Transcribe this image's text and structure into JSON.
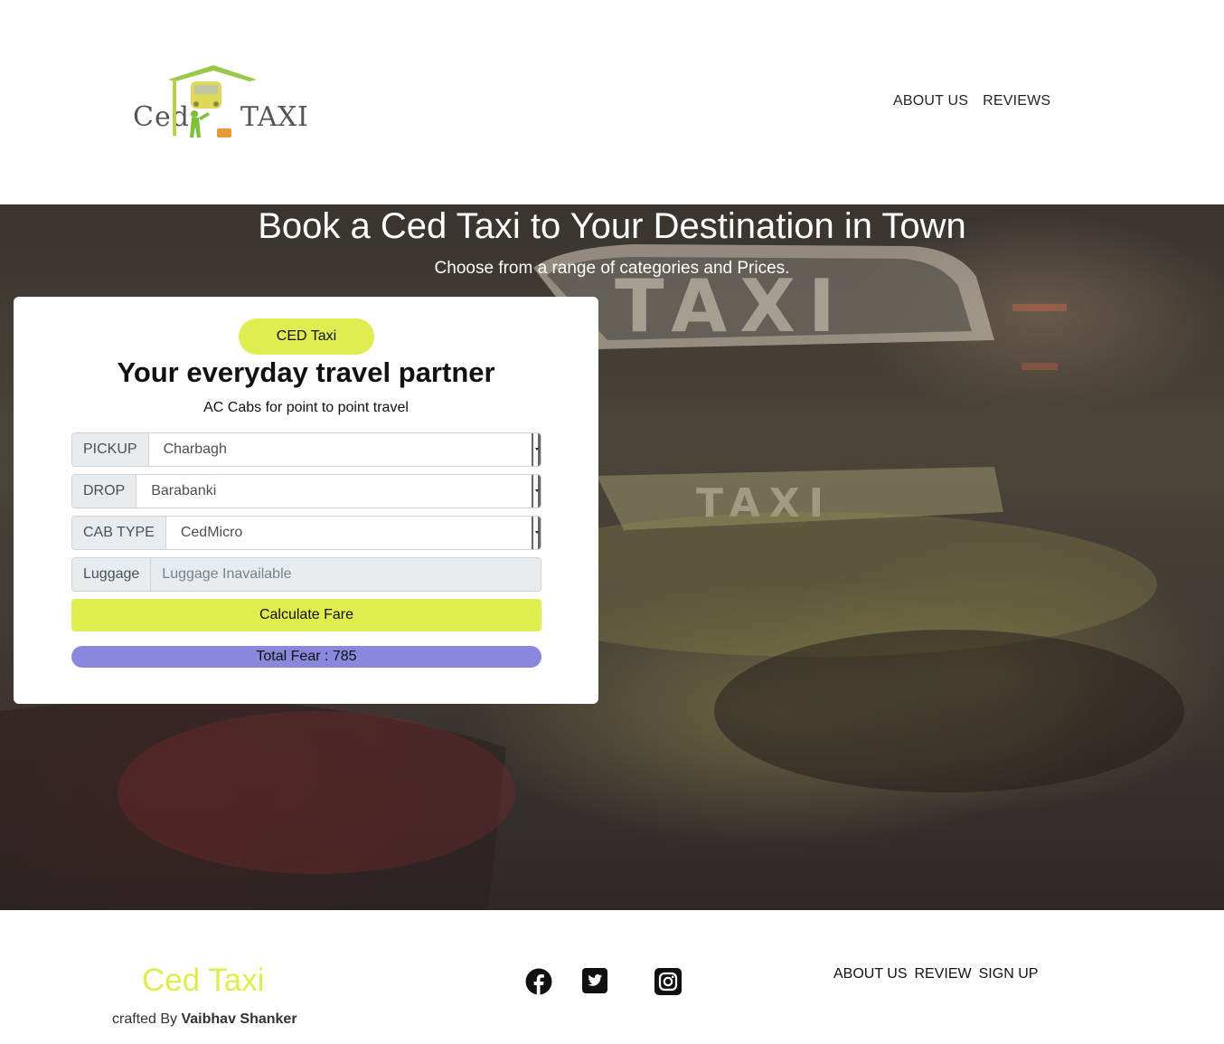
{
  "header": {
    "logo": {
      "word_left": "Ced",
      "word_right": "TAXI"
    },
    "nav": {
      "about": "ABOUT US",
      "reviews": "REVIEWS"
    }
  },
  "hero": {
    "title": "Book a Ced Taxi to Your Destination in Town",
    "subtitle": "Choose from a range of categories and Prices."
  },
  "card": {
    "pill": "CED Taxi",
    "title": "Your everyday travel partner",
    "subtitle": "AC Cabs for point to point travel",
    "pickup": {
      "label": "PICKUP",
      "value": "Charbagh"
    },
    "drop": {
      "label": "DROP",
      "value": "Barabanki"
    },
    "cab_type": {
      "label": "CAB TYPE",
      "value": "CedMicro"
    },
    "luggage": {
      "label": "Luggage",
      "placeholder": "Luggage Inavailable"
    },
    "calculate_label": "Calculate Fare",
    "total_label": "Total Fear : 785"
  },
  "footer": {
    "brand": "Ced Taxi",
    "credit_prefix": "crafted By",
    "credit_name": "Vaibhav Shanker",
    "social": [
      "facebook-icon",
      "twitter-icon",
      "instagram-icon"
    ],
    "nav": {
      "about": "ABOUT US",
      "review": "REVIEW",
      "signup": "SIGN UP"
    }
  },
  "colors": {
    "accent_yellow": "#dfed50",
    "fare_purple": "#8a88dc",
    "logo_green": "#9cc84a"
  }
}
